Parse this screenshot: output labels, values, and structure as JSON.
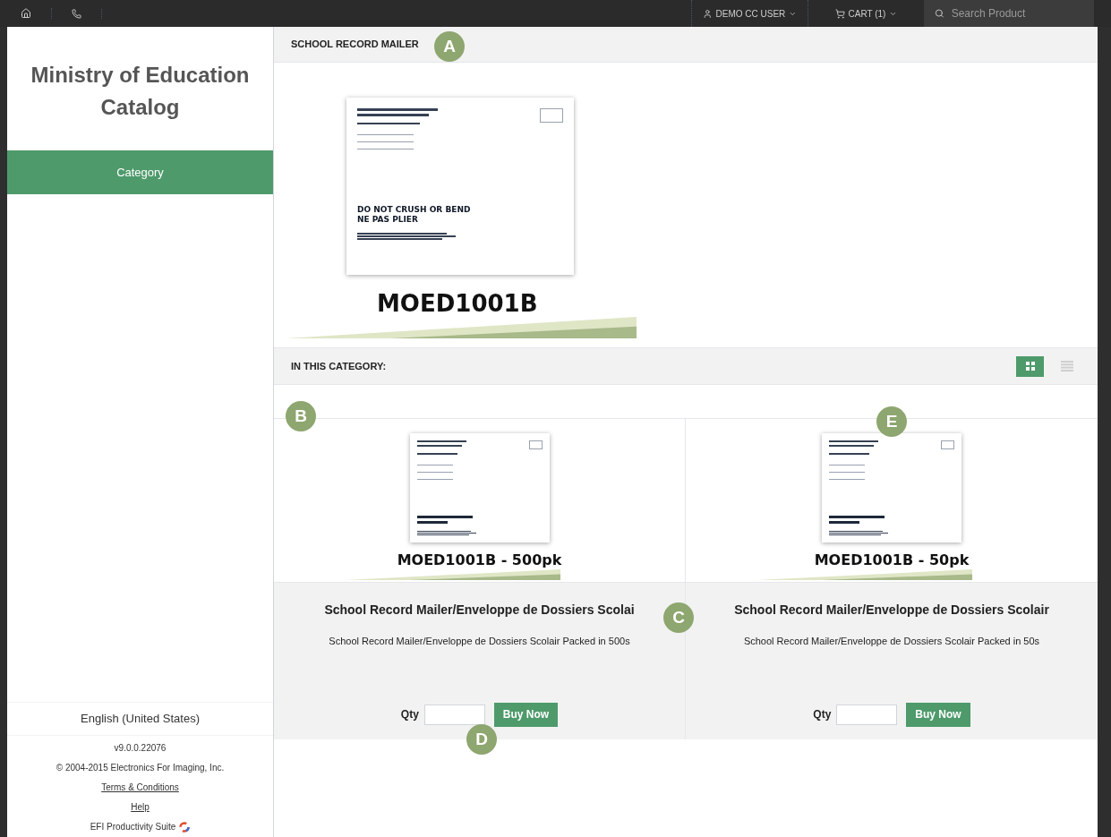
{
  "topbar": {
    "user": "DEMO CC USER",
    "cart": "CART (1)",
    "search": {
      "placeholder": "Search Product"
    }
  },
  "sidebar": {
    "title": "Ministry of Education Catalog",
    "items": [
      {
        "label": "Category",
        "selected": true
      }
    ],
    "language": "English (United States)",
    "version": "v9.0.0.22076",
    "copyright": "© 2004-2015 Electronics For Imaging, Inc.",
    "links": [
      "Terms & Conditions",
      "Help"
    ],
    "suite": "EFI Productivity Suite"
  },
  "product": {
    "title": "SCHOOL RECORD MAILER",
    "image": {
      "caption": "MOED1001B",
      "lines": [
        "DO NOT CRUSH OR BEND",
        "NE PAS PLIER"
      ]
    }
  },
  "category": {
    "title": "IN THIS CATEGORY:",
    "views": [
      {
        "kind": "grid",
        "selected": true
      },
      {
        "kind": "list",
        "selected": false
      }
    ],
    "items": [
      {
        "caption": "MOED1001B - 500pk",
        "name": "School Record Mailer/Enveloppe de Dossiers Scolai",
        "description": "School Record Mailer/Enveloppe de Dossiers Scolair Packed in 500s",
        "qty_label": "Qty",
        "button": "Buy Now"
      },
      {
        "caption": "MOED1001B - 50pk",
        "name": "School Record Mailer/Enveloppe de Dossiers Scolair",
        "description": "School Record Mailer/Enveloppe de Dossiers Scolair Packed in 50s",
        "qty_label": "Qty",
        "button": "Buy Now"
      }
    ]
  },
  "callouts": [
    "A",
    "B",
    "C",
    "D",
    "E"
  ]
}
